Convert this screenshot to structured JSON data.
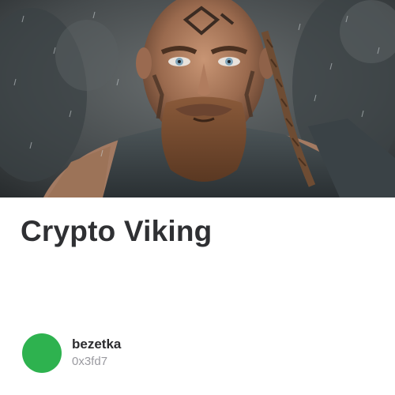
{
  "card": {
    "title": "Crypto Viking",
    "image_alt": "viking-warrior-portrait",
    "author": {
      "name": "bezetka",
      "address": "0x3fd7"
    }
  },
  "colors": {
    "avatar": "#2eb24f",
    "title_text": "#2f3033",
    "address_text": "#9a9aa0"
  }
}
